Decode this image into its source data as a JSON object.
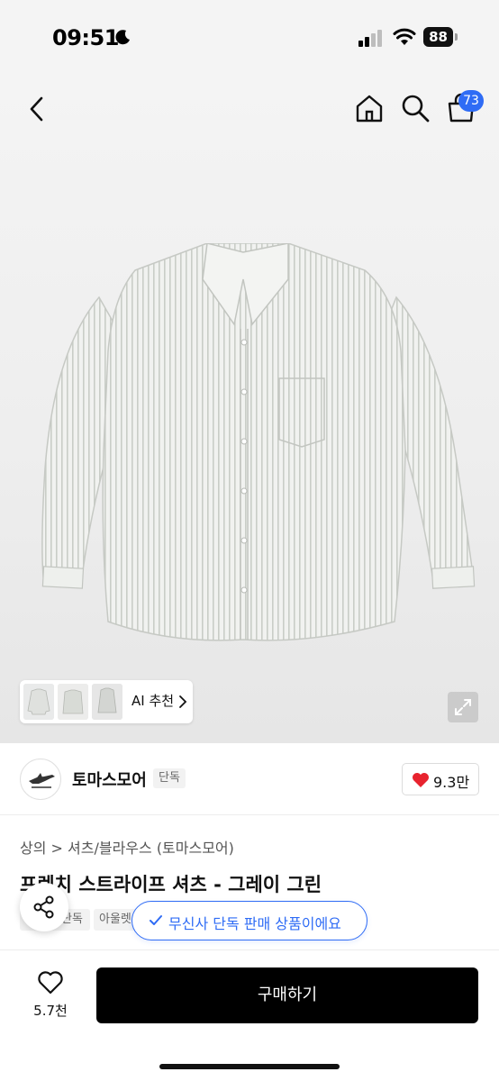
{
  "status_bar": {
    "time": "09:51",
    "battery": "88"
  },
  "header": {
    "cart_count": "73"
  },
  "gallery": {
    "ai_recommend_label": "AI 추천"
  },
  "brand": {
    "name": "토마스모어",
    "exclusive_chip": "단독",
    "like_count": "9.3만"
  },
  "product": {
    "breadcrumb": "상의 > 셔츠/블라우스 (토마스모어)",
    "title": "프렌치 스트라이프 셔츠 - 그레이 그린",
    "tags": [
      "무신사 단독",
      "아울렛"
    ]
  },
  "exclusive_notice": "무신사 단독 판매 상품이에요",
  "bottom_bar": {
    "wish_count": "5.7천",
    "buy_label": "구매하기"
  },
  "colors": {
    "accent_blue": "#2f6cf5",
    "buy_button": "#000000",
    "heart_red": "#e8232e"
  }
}
